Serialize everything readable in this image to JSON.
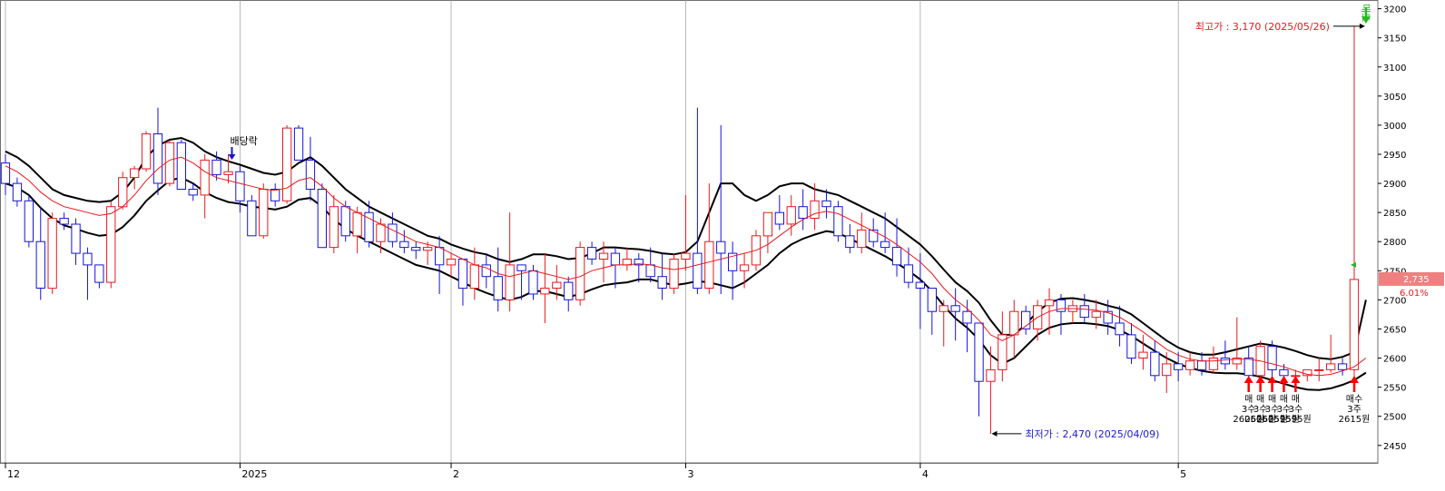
{
  "colors": {
    "up": "#e8191d",
    "down": "#1515d6",
    "band": "#000000",
    "ma": "#e8191d",
    "grid": "#9a9a9a",
    "buy_marker": "#ff0000",
    "sell_marker": "#22bb22",
    "annot_high": "#e8191d",
    "annot_low": "#1a1ad6",
    "price_badge": "#f08080"
  },
  "chart_data": {
    "type": "candlestick",
    "title": "",
    "ylim": [
      2420,
      3215
    ],
    "y_ticks": [
      2450,
      2500,
      2550,
      2600,
      2650,
      2700,
      2750,
      2800,
      2850,
      2900,
      2950,
      3000,
      3050,
      3100,
      3150,
      3200
    ],
    "x_ticks": [
      {
        "label": "12",
        "index": 0
      },
      {
        "label": "2025",
        "index": 20
      },
      {
        "label": "2",
        "index": 38
      },
      {
        "label": "3",
        "index": 58
      },
      {
        "label": "4",
        "index": 78
      },
      {
        "label": "5",
        "index": 100
      }
    ],
    "candles": [
      [
        2935,
        2950,
        2880,
        2900
      ],
      [
        2900,
        2910,
        2860,
        2870
      ],
      [
        2870,
        2880,
        2790,
        2800
      ],
      [
        2800,
        2860,
        2700,
        2720
      ],
      [
        2720,
        2850,
        2710,
        2840
      ],
      [
        2840,
        2850,
        2820,
        2830
      ],
      [
        2830,
        2840,
        2760,
        2780
      ],
      [
        2780,
        2790,
        2700,
        2760
      ],
      [
        2760,
        2760,
        2720,
        2730
      ],
      [
        2730,
        2870,
        2720,
        2860
      ],
      [
        2860,
        2920,
        2855,
        2910
      ],
      [
        2910,
        2930,
        2890,
        2925
      ],
      [
        2925,
        2990,
        2920,
        2985
      ],
      [
        2985,
        3030,
        2880,
        2900
      ],
      [
        2900,
        2975,
        2895,
        2970
      ],
      [
        2970,
        2975,
        2890,
        2890
      ],
      [
        2890,
        2900,
        2870,
        2880
      ],
      [
        2880,
        2950,
        2840,
        2940
      ],
      [
        2940,
        2955,
        2905,
        2915
      ],
      [
        2915,
        2950,
        2900,
        2920
      ],
      [
        2920,
        2930,
        2850,
        2870
      ],
      [
        2870,
        2880,
        2810,
        2810
      ],
      [
        2810,
        2900,
        2805,
        2890
      ],
      [
        2890,
        2900,
        2860,
        2870
      ],
      [
        2870,
        3000,
        2865,
        2995
      ],
      [
        2995,
        3000,
        2940,
        2940
      ],
      [
        2940,
        2980,
        2870,
        2890
      ],
      [
        2890,
        2900,
        2790,
        2790
      ],
      [
        2790,
        2880,
        2780,
        2860
      ],
      [
        2860,
        2870,
        2800,
        2810
      ],
      [
        2810,
        2860,
        2780,
        2850
      ],
      [
        2850,
        2870,
        2790,
        2800
      ],
      [
        2800,
        2840,
        2780,
        2830
      ],
      [
        2830,
        2850,
        2790,
        2800
      ],
      [
        2800,
        2820,
        2780,
        2790
      ],
      [
        2790,
        2800,
        2770,
        2785
      ],
      [
        2785,
        2800,
        2760,
        2790
      ],
      [
        2790,
        2810,
        2710,
        2760
      ],
      [
        2760,
        2780,
        2740,
        2770
      ],
      [
        2770,
        2770,
        2690,
        2720
      ],
      [
        2720,
        2790,
        2700,
        2760
      ],
      [
        2760,
        2780,
        2720,
        2740
      ],
      [
        2740,
        2790,
        2680,
        2700
      ],
      [
        2700,
        2850,
        2680,
        2760
      ],
      [
        2760,
        2760,
        2700,
        2750
      ],
      [
        2750,
        2760,
        2700,
        2710
      ],
      [
        2710,
        2780,
        2660,
        2720
      ],
      [
        2720,
        2760,
        2700,
        2730
      ],
      [
        2730,
        2740,
        2680,
        2700
      ],
      [
        2700,
        2800,
        2690,
        2790
      ],
      [
        2790,
        2800,
        2760,
        2770
      ],
      [
        2770,
        2800,
        2730,
        2780
      ],
      [
        2780,
        2790,
        2720,
        2760
      ],
      [
        2760,
        2790,
        2750,
        2770
      ],
      [
        2770,
        2780,
        2730,
        2760
      ],
      [
        2760,
        2790,
        2730,
        2740
      ],
      [
        2740,
        2780,
        2700,
        2720
      ],
      [
        2720,
        2780,
        2710,
        2770
      ],
      [
        2770,
        2880,
        2750,
        2780
      ],
      [
        2780,
        3030,
        2710,
        2720
      ],
      [
        2720,
        2900,
        2710,
        2800
      ],
      [
        2800,
        3000,
        2710,
        2780
      ],
      [
        2780,
        2800,
        2700,
        2750
      ],
      [
        2750,
        2780,
        2720,
        2760
      ],
      [
        2760,
        2820,
        2750,
        2810
      ],
      [
        2810,
        2850,
        2780,
        2850
      ],
      [
        2850,
        2880,
        2820,
        2830
      ],
      [
        2830,
        2880,
        2810,
        2860
      ],
      [
        2860,
        2890,
        2820,
        2840
      ],
      [
        2840,
        2900,
        2820,
        2870
      ],
      [
        2870,
        2890,
        2840,
        2860
      ],
      [
        2860,
        2870,
        2800,
        2810
      ],
      [
        2810,
        2830,
        2780,
        2790
      ],
      [
        2790,
        2850,
        2780,
        2820
      ],
      [
        2820,
        2840,
        2790,
        2800
      ],
      [
        2800,
        2850,
        2780,
        2790
      ],
      [
        2790,
        2840,
        2740,
        2760
      ],
      [
        2760,
        2790,
        2720,
        2730
      ],
      [
        2730,
        2780,
        2650,
        2720
      ],
      [
        2720,
        2720,
        2640,
        2680
      ],
      [
        2680,
        2700,
        2620,
        2690
      ],
      [
        2690,
        2720,
        2630,
        2680
      ],
      [
        2680,
        2700,
        2610,
        2660
      ],
      [
        2660,
        2660,
        2500,
        2560
      ],
      [
        2560,
        2620,
        2470,
        2580
      ],
      [
        2580,
        2680,
        2560,
        2640
      ],
      [
        2640,
        2700,
        2600,
        2680
      ],
      [
        2680,
        2690,
        2640,
        2650
      ],
      [
        2650,
        2700,
        2630,
        2690
      ],
      [
        2690,
        2720,
        2640,
        2700
      ],
      [
        2700,
        2710,
        2640,
        2680
      ],
      [
        2680,
        2700,
        2660,
        2690
      ],
      [
        2690,
        2710,
        2660,
        2670
      ],
      [
        2670,
        2700,
        2650,
        2680
      ],
      [
        2680,
        2700,
        2640,
        2660
      ],
      [
        2660,
        2690,
        2620,
        2640
      ],
      [
        2640,
        2660,
        2590,
        2600
      ],
      [
        2600,
        2640,
        2580,
        2610
      ],
      [
        2610,
        2630,
        2560,
        2570
      ],
      [
        2570,
        2610,
        2540,
        2590
      ],
      [
        2590,
        2610,
        2560,
        2580
      ],
      [
        2580,
        2610,
        2570,
        2595
      ],
      [
        2595,
        2610,
        2570,
        2580
      ],
      [
        2580,
        2620,
        2575,
        2600
      ],
      [
        2600,
        2630,
        2580,
        2590
      ],
      [
        2590,
        2670,
        2580,
        2600
      ],
      [
        2600,
        2620,
        2560,
        2570
      ],
      [
        2570,
        2630,
        2560,
        2620
      ],
      [
        2620,
        2630,
        2560,
        2580
      ],
      [
        2580,
        2590,
        2560,
        2570
      ],
      [
        2570,
        2580,
        2545,
        2570
      ],
      [
        2570,
        2580,
        2560,
        2580
      ],
      [
        2580,
        2600,
        2560,
        2580
      ],
      [
        2580,
        2640,
        2575,
        2590
      ],
      [
        2590,
        2600,
        2570,
        2580
      ],
      [
        2580,
        3170,
        2560,
        2735
      ]
    ],
    "ma": {
      "name": "",
      "values": [
        2930,
        2920,
        2905,
        2885,
        2870,
        2860,
        2855,
        2850,
        2845,
        2848,
        2860,
        2880,
        2905,
        2925,
        2940,
        2945,
        2935,
        2920,
        2910,
        2905,
        2900,
        2895,
        2890,
        2888,
        2892,
        2905,
        2910,
        2895,
        2875,
        2860,
        2850,
        2840,
        2830,
        2820,
        2810,
        2800,
        2795,
        2790,
        2780,
        2770,
        2760,
        2755,
        2745,
        2740,
        2745,
        2750,
        2745,
        2740,
        2735,
        2740,
        2750,
        2755,
        2760,
        2760,
        2762,
        2760,
        2755,
        2752,
        2755,
        2760,
        2765,
        2770,
        2775,
        2780,
        2785,
        2795,
        2810,
        2825,
        2838,
        2848,
        2852,
        2848,
        2838,
        2828,
        2818,
        2808,
        2795,
        2780,
        2765,
        2745,
        2720,
        2700,
        2685,
        2665,
        2640,
        2630,
        2640,
        2655,
        2670,
        2680,
        2685,
        2685,
        2684,
        2682,
        2678,
        2670,
        2658,
        2645,
        2630,
        2615,
        2605,
        2598,
        2595,
        2595,
        2597,
        2598,
        2598,
        2595,
        2590,
        2585,
        2578,
        2572,
        2570,
        2572,
        2578,
        2585,
        2600
      ]
    },
    "bands": {
      "upper": [
        2955,
        2945,
        2930,
        2910,
        2890,
        2880,
        2875,
        2870,
        2868,
        2870,
        2885,
        2910,
        2945,
        2965,
        2975,
        2978,
        2970,
        2955,
        2945,
        2938,
        2932,
        2925,
        2918,
        2915,
        2920,
        2935,
        2945,
        2930,
        2910,
        2890,
        2875,
        2860,
        2850,
        2840,
        2830,
        2820,
        2810,
        2805,
        2795,
        2788,
        2782,
        2778,
        2770,
        2765,
        2770,
        2778,
        2778,
        2775,
        2770,
        2772,
        2780,
        2790,
        2790,
        2788,
        2787,
        2784,
        2780,
        2778,
        2782,
        2800,
        2850,
        2900,
        2900,
        2880,
        2870,
        2880,
        2895,
        2900,
        2900,
        2890,
        2885,
        2880,
        2870,
        2860,
        2850,
        2840,
        2825,
        2810,
        2795,
        2775,
        2752,
        2730,
        2715,
        2695,
        2665,
        2640,
        2640,
        2658,
        2680,
        2695,
        2702,
        2703,
        2700,
        2696,
        2690,
        2685,
        2675,
        2660,
        2645,
        2630,
        2618,
        2610,
        2606,
        2606,
        2610,
        2615,
        2620,
        2625,
        2622,
        2618,
        2612,
        2605,
        2600,
        2598,
        2602,
        2610,
        2700
      ],
      "lower": [
        2900,
        2893,
        2880,
        2858,
        2840,
        2828,
        2822,
        2815,
        2810,
        2812,
        2825,
        2845,
        2870,
        2888,
        2905,
        2910,
        2900,
        2885,
        2875,
        2868,
        2865,
        2860,
        2858,
        2855,
        2860,
        2872,
        2875,
        2860,
        2838,
        2822,
        2810,
        2800,
        2790,
        2780,
        2770,
        2760,
        2755,
        2750,
        2740,
        2730,
        2720,
        2712,
        2705,
        2700,
        2705,
        2715,
        2715,
        2710,
        2705,
        2710,
        2718,
        2725,
        2728,
        2730,
        2735,
        2735,
        2730,
        2725,
        2728,
        2732,
        2730,
        2725,
        2720,
        2730,
        2745,
        2760,
        2780,
        2795,
        2805,
        2812,
        2818,
        2815,
        2805,
        2795,
        2785,
        2775,
        2763,
        2750,
        2735,
        2715,
        2690,
        2668,
        2652,
        2632,
        2605,
        2590,
        2600,
        2620,
        2640,
        2652,
        2658,
        2660,
        2660,
        2658,
        2655,
        2648,
        2638,
        2625,
        2612,
        2600,
        2590,
        2583,
        2578,
        2575,
        2574,
        2574,
        2572,
        2568,
        2562,
        2556,
        2550,
        2546,
        2545,
        2548,
        2554,
        2562,
        2575
      ]
    },
    "annotations": {
      "high": {
        "text": "최고가 : 3,170 (2025/05/26)",
        "value": 3170,
        "index": 116
      },
      "low": {
        "text": "최저가 : 2,470 (2025/04/09)",
        "value": 2470,
        "index": 84
      },
      "dividend": {
        "text": "배당락",
        "index": 19
      },
      "sell": {
        "text": "매도",
        "index": 116
      }
    },
    "buy_signals": [
      {
        "index": 106,
        "lines": [
          "매",
          "3수",
          "2605원"
        ]
      },
      {
        "index": 107,
        "lines": [
          "매",
          "3수",
          "2605원"
        ]
      },
      {
        "index": 108,
        "lines": [
          "매",
          "3수",
          "2605원"
        ]
      },
      {
        "index": 109,
        "lines": [
          "매",
          "3수",
          "2595원"
        ]
      },
      {
        "index": 110,
        "lines": [
          "매",
          "3수",
          "2595원"
        ]
      },
      {
        "index": 115,
        "lines": [
          "매수",
          "3주",
          "2615원"
        ]
      }
    ],
    "current_price": {
      "value": 2735,
      "label": "2,735",
      "change": "6.01%"
    }
  }
}
